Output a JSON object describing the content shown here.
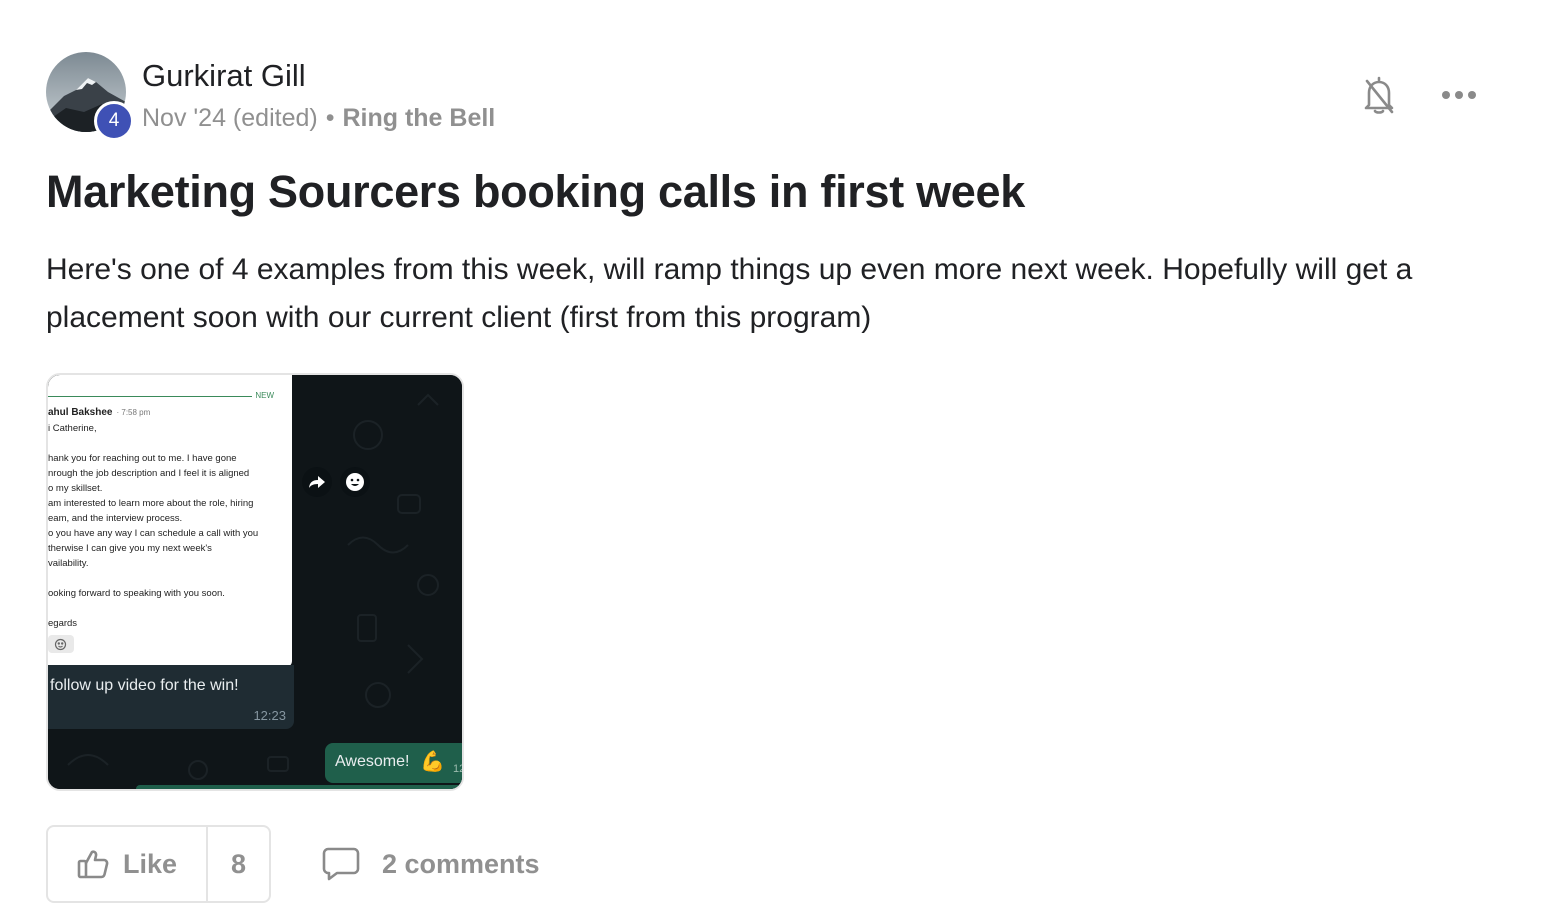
{
  "post": {
    "author": {
      "name": "Gurkirat Gill",
      "level": "4"
    },
    "meta": {
      "date": "Nov '24 (edited)",
      "separator": "•",
      "category": "Ring the Bell"
    },
    "actions": {
      "bell_icon": "bell-off-icon",
      "more_icon": "more-horizontal-icon"
    },
    "title": "Marketing Sourcers booking calls in first week",
    "body": "Here's one of 4 examples from this week, will ramp things up even more next week. Hopefully will get a placement soon with our current client (first from this program)",
    "attachment": {
      "email": {
        "new_label": "NEW",
        "sender": "ahul Bakshee",
        "time": "· 7:58 pm",
        "lines": [
          "i Catherine,",
          "hank you for reaching out to me. I have gone",
          "nrough the job description and I feel it is aligned",
          "o my skillset.",
          "am interested to learn more about the role, hiring",
          "eam, and the interview process.",
          "o you have any way I can schedule a call with you",
          "therwise I can give you my next week's",
          "vailability.",
          "ooking forward to speaking with you soon.",
          "egards"
        ]
      },
      "incoming_message": {
        "text": "follow up video for the win!",
        "time": "12:23"
      },
      "outgoing_message": {
        "text": "Awesome!",
        "emoji": "💪",
        "time": "12"
      }
    },
    "footer": {
      "like_label": "Like",
      "like_count": "8",
      "comments_label": "2 comments"
    }
  }
}
